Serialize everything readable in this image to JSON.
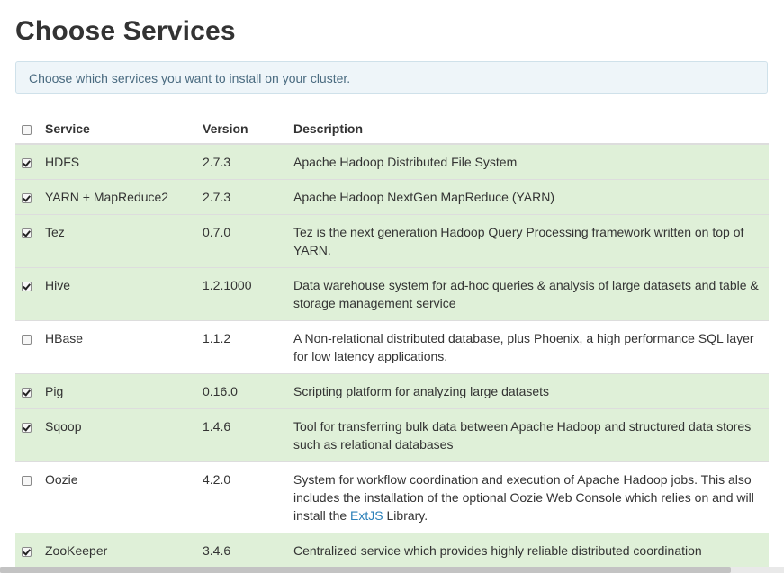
{
  "page": {
    "title": "Choose Services",
    "info_text": "Choose which services you want to install on your cluster."
  },
  "table": {
    "headers": {
      "service": "Service",
      "version": "Version",
      "description": "Description"
    },
    "select_all_checked": false,
    "rows": [
      {
        "service": "HDFS",
        "version": "2.7.3",
        "description": "Apache Hadoop Distributed File System",
        "checked": true
      },
      {
        "service": "YARN + MapReduce2",
        "version": "2.7.3",
        "description": "Apache Hadoop NextGen MapReduce (YARN)",
        "checked": true
      },
      {
        "service": "Tez",
        "version": "0.7.0",
        "description": "Tez is the next generation Hadoop Query Processing framework written on top of YARN.",
        "checked": true
      },
      {
        "service": "Hive",
        "version": "1.2.1000",
        "description": "Data warehouse system for ad-hoc queries & analysis of large datasets and table & storage management service",
        "checked": true
      },
      {
        "service": "HBase",
        "version": "1.1.2",
        "description": "A Non-relational distributed database, plus Phoenix, a high performance SQL layer for low latency applications.",
        "checked": false
      },
      {
        "service": "Pig",
        "version": "0.16.0",
        "description": "Scripting platform for analyzing large datasets",
        "checked": true
      },
      {
        "service": "Sqoop",
        "version": "1.4.6",
        "description": "Tool for transferring bulk data between Apache Hadoop and structured data stores such as relational databases",
        "checked": true
      },
      {
        "service": "Oozie",
        "version": "4.2.0",
        "description_before_link": "System for workflow coordination and execution of Apache Hadoop jobs. This also includes the installation of the optional Oozie Web Console which relies on and will install the ",
        "description_link": "ExtJS",
        "description_after_link": " Library.",
        "checked": false
      },
      {
        "service": "ZooKeeper",
        "version": "3.4.6",
        "description": "Centralized service which provides highly reliable distributed coordination",
        "checked": true
      }
    ]
  },
  "colors": {
    "selected_row": "#dff0d8",
    "info_background": "#eef5f9",
    "link": "#2a7fb8"
  }
}
